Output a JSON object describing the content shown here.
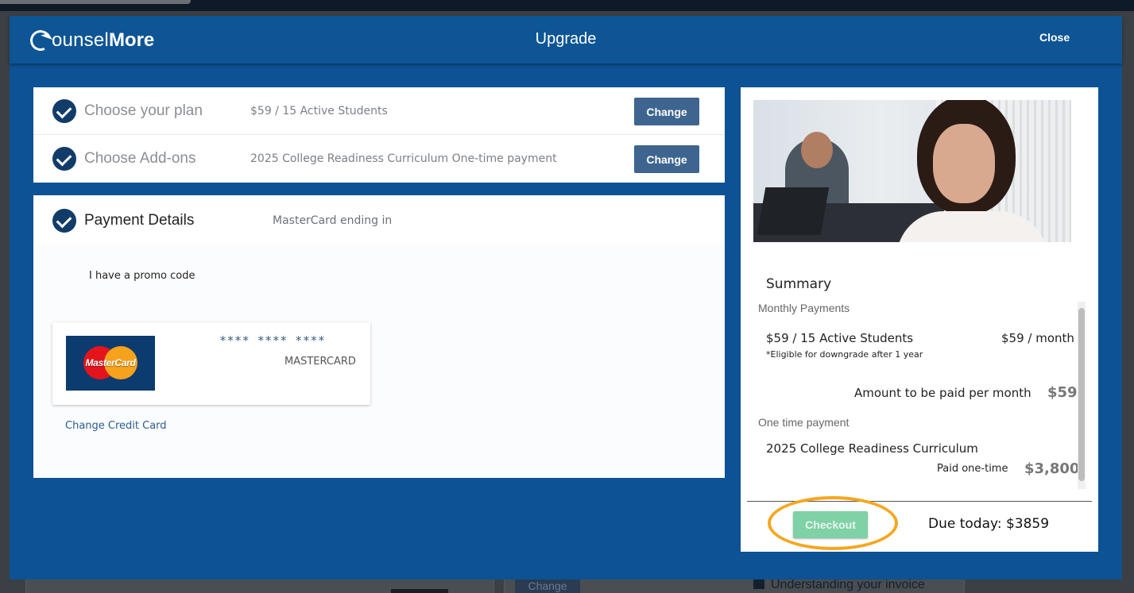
{
  "header": {
    "logo_part1": "ounsel",
    "logo_part2": "More",
    "title": "Upgrade",
    "close_label": "Close"
  },
  "plan_steps": [
    {
      "label": "Choose your plan",
      "value": "$59 / 15 Active Students",
      "button": "Change"
    },
    {
      "label": "Choose Add-ons",
      "value": "2025 College Readiness Curriculum One-time payment",
      "button": "Change"
    }
  ],
  "payment": {
    "label": "Payment Details",
    "value": "MasterCard ending in",
    "promo_label": "I have a promo code",
    "card_logo_text": "MasterCard",
    "card_number": "**** **** ****",
    "card_brand": "MASTERCARD",
    "change_card_label": "Change Credit Card"
  },
  "summary": {
    "title": "Summary",
    "monthly_label": "Monthly Payments",
    "plan_name": "$59 / 15 Active Students",
    "plan_price": "$59 / month",
    "plan_note": "*Eligible for downgrade after 1 year",
    "monthly_total_label": "Amount to be paid per month",
    "monthly_total": "$59",
    "onetime_label": "One time payment",
    "onetime_item": "2025 College Readiness Curriculum",
    "onetime_paid_label": "Paid one-time",
    "onetime_total": "$3,800",
    "checkout_label": "Checkout",
    "due_today": "Due today: $3859"
  },
  "background": {
    "change_label": "Change",
    "invoice_link": "Understanding your invoice"
  },
  "colors": {
    "modal_bg": "#0d5294",
    "change_button": "#3d6590",
    "check_circle": "#113c69",
    "checkout_button": "#7fd1a6",
    "highlight_ring": "#f5a71f"
  }
}
